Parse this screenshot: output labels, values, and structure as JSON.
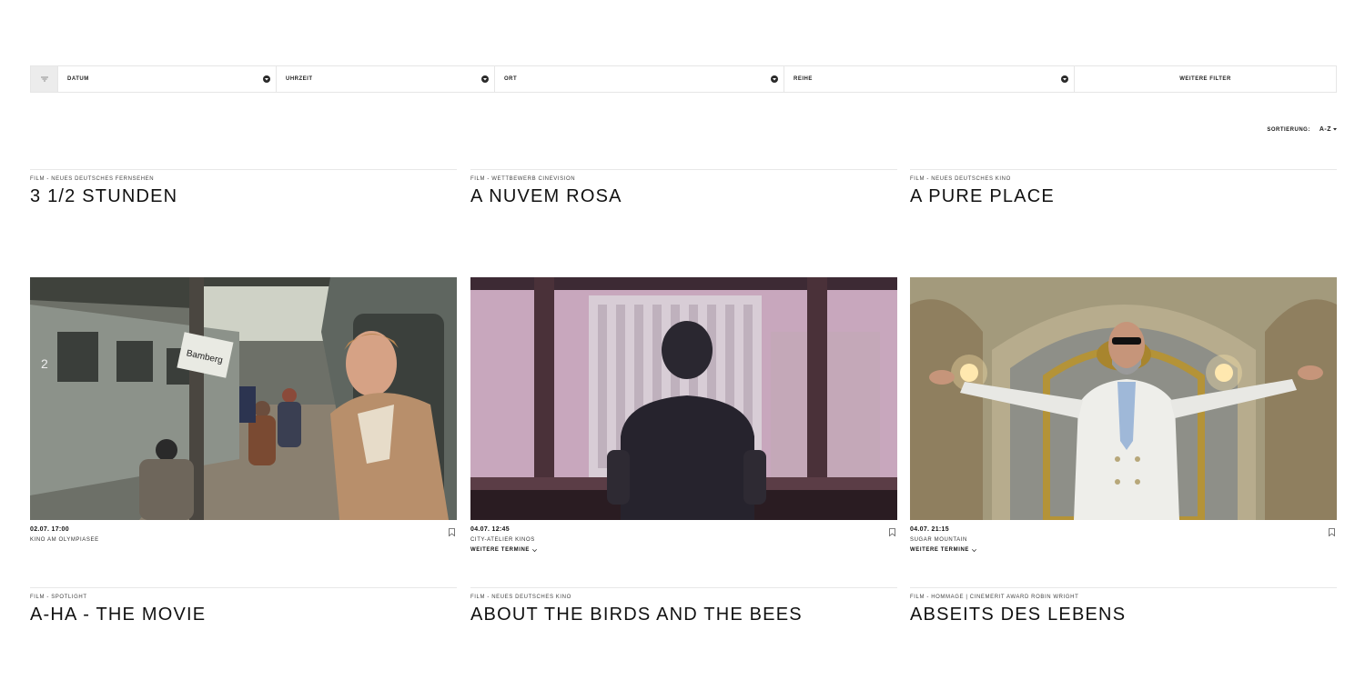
{
  "filters": {
    "toggle_icon": "filter-lines-icon",
    "datum": "DATUM",
    "uhrzeit": "UHRZEIT",
    "ort": "ORT",
    "reihe": "REIHE",
    "more": "WEITERE FILTER"
  },
  "sort": {
    "label": "SORTIERUNG:",
    "value": "A-Z"
  },
  "cards": [
    {
      "category": "FILM - NEUES DEUTSCHES FERNSEHEN",
      "title": "3 1/2 STUNDEN",
      "datetime": "02.07. 17:00",
      "venue": "KINO AM OLYMPIASEE",
      "more_dates": ""
    },
    {
      "category": "FILM - WETTBEWERB CINEVISION",
      "title": "A NUVEM ROSA",
      "datetime": "04.07. 12:45",
      "venue": "CITY-ATELIER KINOS",
      "more_dates": "WEITERE TERMINE"
    },
    {
      "category": "FILM - NEUES DEUTSCHES KINO",
      "title": "A PURE PLACE",
      "datetime": "04.07. 21:15",
      "venue": "SUGAR MOUNTAIN",
      "more_dates": "WEITERE TERMINE"
    },
    {
      "category": "FILM - SPOTLIGHT",
      "title": "A-HA - THE MOVIE"
    },
    {
      "category": "FILM - NEUES DEUTSCHES KINO",
      "title": "ABOUT THE BIRDS AND THE BEES"
    },
    {
      "category": "FILM - HOMMAGE | CINEMERIT AWARD ROBIN WRIGHT",
      "title": "ABSEITS DES LEBENS"
    }
  ],
  "images": {
    "station_sign": "Bamberg",
    "carriage_number": "2"
  }
}
